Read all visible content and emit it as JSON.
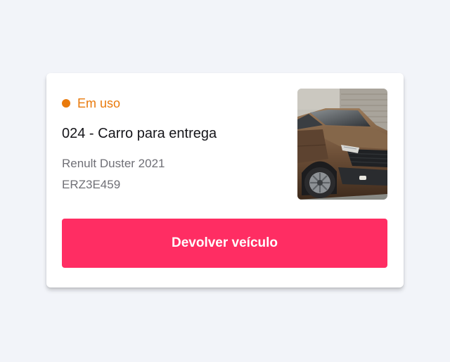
{
  "colors": {
    "status": "#e97a0c",
    "button": "#ff2d63"
  },
  "status": {
    "label": "Em uso"
  },
  "vehicle": {
    "title": "024 - Carro para entrega",
    "model": "Renult Duster 2021",
    "plate": "ERZ3E459",
    "photo_subject": "brown-suv"
  },
  "actions": {
    "return_label": "Devolver veículo"
  }
}
